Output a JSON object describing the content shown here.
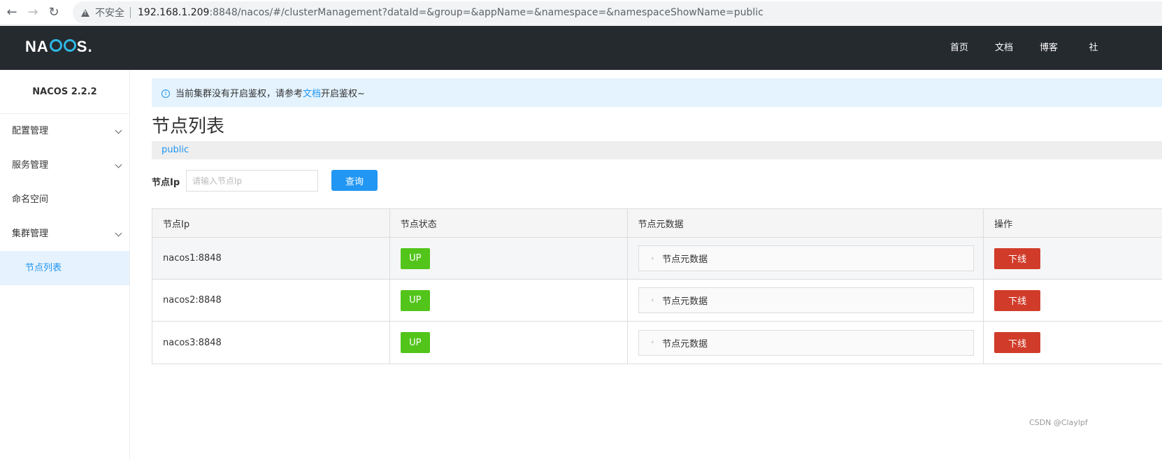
{
  "browser": {
    "back": "←",
    "forward": "→",
    "reload": "↻",
    "insecure_label": "不安全",
    "url_host": "192.168.1.209",
    "url_path": ":8848/nacos/#/clusterManagement?dataId=&group=&appName=&namespace=&namespaceShowName=public"
  },
  "header": {
    "logo_n": "NA",
    "logo_s": "S.",
    "menu": [
      "首页",
      "文档",
      "博客",
      "社"
    ]
  },
  "sidebar": {
    "title": "NACOS 2.2.2",
    "items": [
      {
        "label": "配置管理"
      },
      {
        "label": "服务管理"
      },
      {
        "label": "命名空间"
      },
      {
        "label": "集群管理"
      }
    ],
    "sub_item": "节点列表"
  },
  "notice": {
    "text_before": "当前集群没有开启鉴权，请参考",
    "link": "文档",
    "text_after": "开启鉴权~"
  },
  "page": {
    "title": "节点列表",
    "namespace": "public",
    "filter_label": "节点Ip",
    "filter_placeholder": "请输入节点Ip",
    "search_label": "查询"
  },
  "table": {
    "headers": [
      "节点Ip",
      "节点状态",
      "节点元数据",
      "操作"
    ],
    "rows": [
      {
        "ip": "nacos1:8848",
        "status": "UP",
        "meta": "节点元数据",
        "action": "下线"
      },
      {
        "ip": "nacos2:8848",
        "status": "UP",
        "meta": "节点元数据",
        "action": "下线"
      },
      {
        "ip": "nacos3:8848",
        "status": "UP",
        "meta": "节点元数据",
        "action": "下线"
      }
    ]
  },
  "watermark": "CSDN @Claylpf",
  "colors": {
    "accent": "#2196f3",
    "header_bg": "#252a2f",
    "status_up": "#52c41a",
    "danger": "#d13c2a"
  }
}
